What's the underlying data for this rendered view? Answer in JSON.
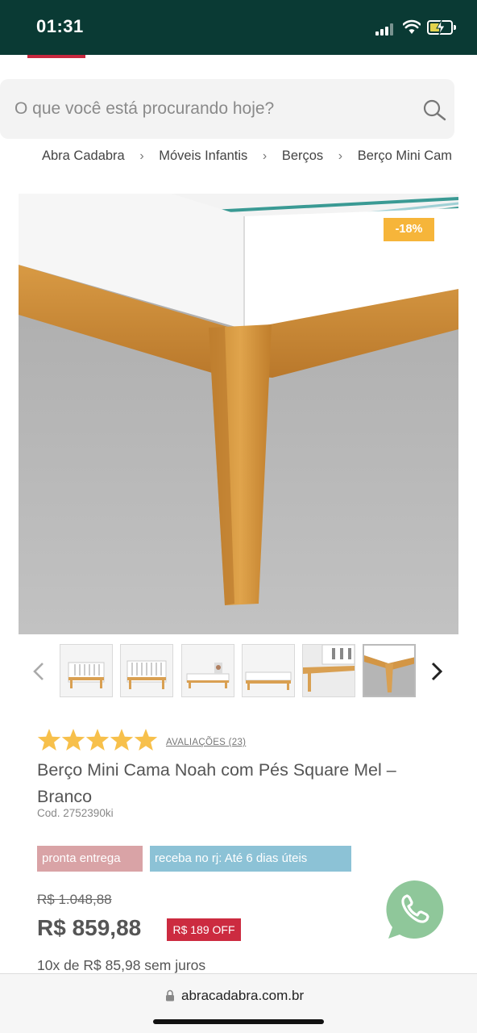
{
  "status_bar": {
    "time": "01:31",
    "background_color": "#0a3a34"
  },
  "search": {
    "placeholder": "O que você está procurando hoje?",
    "icon": "search-icon"
  },
  "breadcrumb": {
    "items": [
      "Abra Cadabra",
      "Móveis Infantis",
      "Berços",
      "Berço Mini Cam"
    ]
  },
  "product": {
    "discount_badge": "-18%",
    "rating_stars": 5,
    "reviews_label": "AVALIAÇÕES (23)",
    "title": "Berço Mini Cama Noah com Pés Square Mel – Branco",
    "code": "Cod. 2752390ki",
    "tags": [
      "pronta entrega",
      "receba no rj: Até 6 dias úteis"
    ],
    "old_price": "R$ 1.048,88",
    "price": "R$ 859,88",
    "off_badge": "R$ 189 OFF",
    "installments": "10x de R$ 85,98 sem juros",
    "thumbnail_count": 6,
    "selected_thumbnail": 6
  },
  "colors": {
    "accent_red": "#c8283f",
    "discount_orange": "#f6b53a",
    "star_yellow": "#f7c04b",
    "tag_pink": "#d9a3a6",
    "tag_blue": "#8cc2d6",
    "whatsapp_green": "#8fc79a"
  },
  "browser": {
    "url": "abracadabra.com.br"
  }
}
